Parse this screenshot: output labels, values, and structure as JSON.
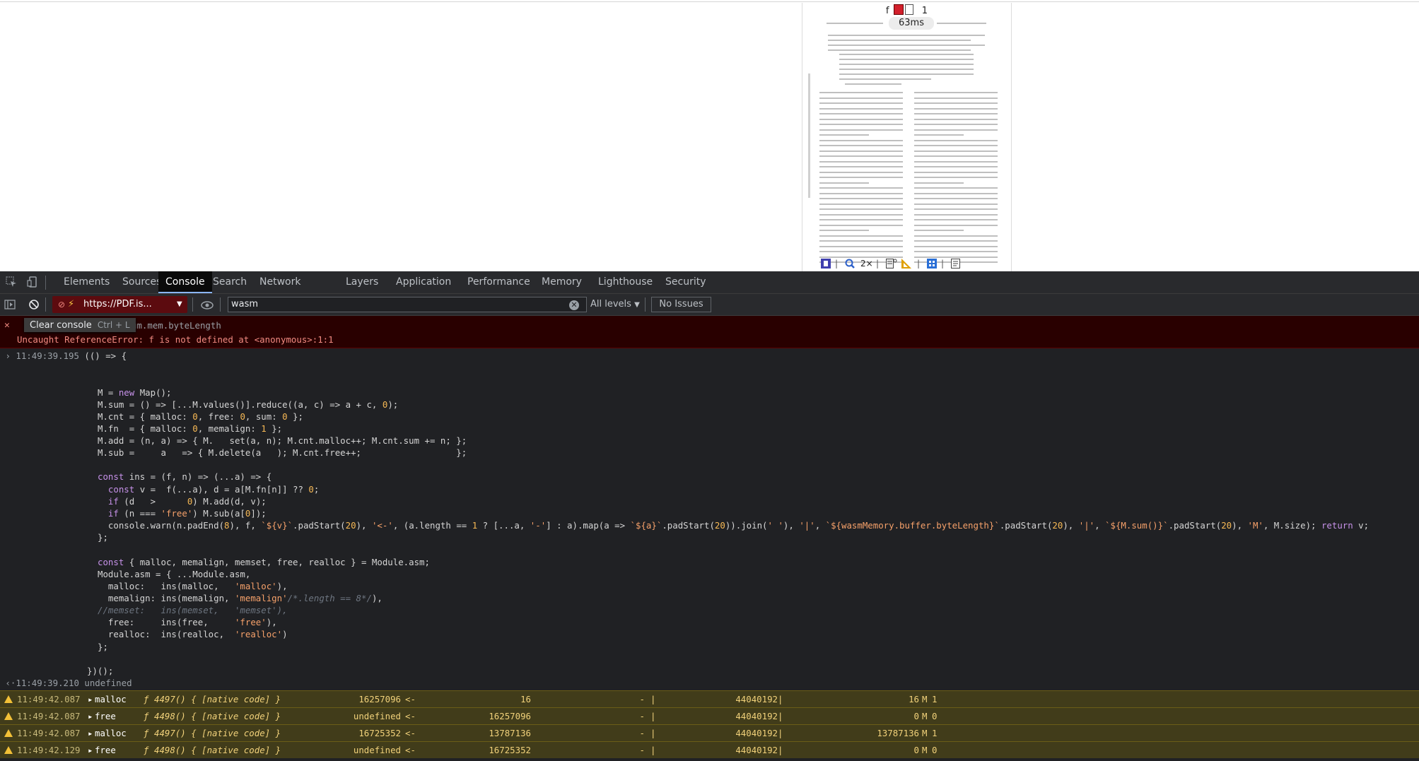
{
  "pdf_preview": {
    "toolbar_top": {
      "left": "f",
      "right": "1"
    },
    "timer": "63ms",
    "zoom": "2×"
  },
  "devtools": {
    "tabs": [
      "Elements",
      "Sources",
      "Console",
      "Search",
      "Network",
      "Layers",
      "Application",
      "Performance",
      "Memory",
      "Lighthouse",
      "Security"
    ],
    "active_tab": "Console",
    "context": "https://PDF.is...",
    "filter_value": "wasm",
    "levels": "All levels",
    "issues": "No Issues",
    "tooltip": {
      "label": "Clear console",
      "shortcut": "Ctrl + L"
    },
    "error": {
      "source_fragment": "um.mem.byteLength",
      "message": "Uncaught ReferenceError: f is not defined at <anonymous>:1:1"
    },
    "input_timestamp": "11:49:39.195",
    "code_lines": [
      "(() => {",
      "",
      "",
      "M = new Map();",
      "M.sum = () => [...M.values()].reduce((a, c) => a + c, 0);",
      "M.cnt = { malloc: 0, free: 0, sum: 0 };",
      "M.fn  = { malloc: 0, memalign: 1 };",
      "M.add = (n, a) => { M.   set(a, n); M.cnt.malloc++; M.cnt.sum += n; };",
      "M.sub =     a   => { M.delete(a   ); M.cnt.free++;                  };",
      "",
      "const ins = (f, n) => (...a) => {",
      "  const v =  f(...a), d = a[M.fn[n]] ?? 0;",
      "  if (d   >      0) M.add(d, v);",
      "  if (n === 'free') M.sub(a[0]);",
      "  console.warn(n.padEnd(8), f, `${v}`.padStart(20), '<-', (a.length == 1 ? [...a, '-'] : a).map(a => `${a}`.padStart(20)).join(' '), '|', `${wasmMemory.buffer.byteLength}`.padStart(20), '|', `${M.sum()}`.padStart(20), 'M', M.size); return v;",
      "};",
      "",
      "const { malloc, memalign, memset, free, realloc } = Module.asm;",
      "Module.asm = { ...Module.asm,",
      "  malloc:   ins(malloc,   'malloc'),",
      "  memalign: ins(memalign, 'memalign'/*.length == 8*/),",
      "//memset:   ins(memset,   'memset'),",
      "  free:     ins(free,     'free'),",
      "  realloc:  ins(realloc,  'realloc')",
      "};",
      "",
      "})();"
    ],
    "result": {
      "timestamp": "11:49:39.210",
      "value": "undefined"
    },
    "warnings": [
      {
        "ts": "11:49:42.087",
        "name": "malloc",
        "fn": "4497() { [native code] }",
        "v": "16257096",
        "a1": "16",
        "a2": "-",
        "mem": "44040192",
        "sum": "16",
        "size": "1"
      },
      {
        "ts": "11:49:42.087",
        "name": "free",
        "fn": "4498() { [native code] }",
        "v": "undefined",
        "a1": "16257096",
        "a2": "-",
        "mem": "44040192",
        "sum": "0",
        "size": "0"
      },
      {
        "ts": "11:49:42.087",
        "name": "malloc",
        "fn": "4497() { [native code] }",
        "v": "16725352",
        "a1": "13787136",
        "a2": "-",
        "mem": "44040192",
        "sum": "13787136",
        "size": "1"
      },
      {
        "ts": "11:49:42.129",
        "name": "free",
        "fn": "4498() { [native code] }",
        "v": "undefined",
        "a1": "16725352",
        "a2": "-",
        "mem": "44040192",
        "sum": "0",
        "size": "0"
      }
    ],
    "arrow": "<-",
    "pipe": "|",
    "m_label": "M",
    "f_glyph": "ƒ"
  },
  "colors": {
    "accent": "#8ab4f8",
    "error_bg": "#290000",
    "warning_bg": "#413c1a",
    "context_bg": "#5c0b0f"
  }
}
